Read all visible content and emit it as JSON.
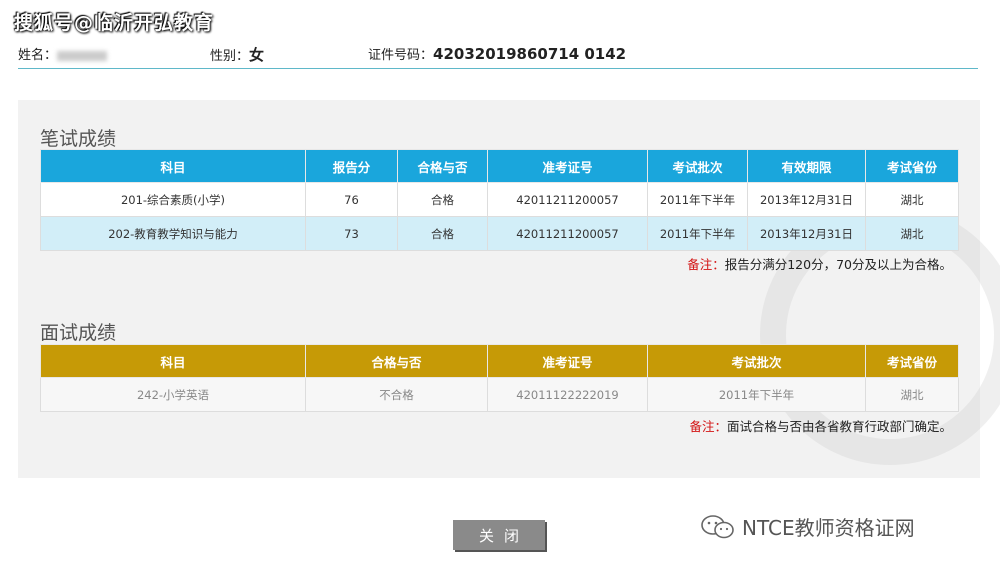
{
  "watermark_top": "搜狐号@临沂开弘教育",
  "info": {
    "name_label": "姓名：",
    "name_value": "",
    "gender_label": "性别：",
    "gender_value": "女",
    "id_label": "证件号码：",
    "id_value": "42032019860714 0142"
  },
  "written": {
    "title": "笔试成绩",
    "headers": [
      "科目",
      "报告分",
      "合格与否",
      "准考证号",
      "考试批次",
      "有效期限",
      "考试省份"
    ],
    "rows": [
      [
        "201-综合素质(小学)",
        "76",
        "合格",
        "42011211200057",
        "2011年下半年",
        "2013年12月31日",
        "湖北"
      ],
      [
        "202-教育教学知识与能力",
        "73",
        "合格",
        "42011211200057",
        "2011年下半年",
        "2013年12月31日",
        "湖北"
      ]
    ],
    "note_label": "备注：",
    "note_text": "报告分满分120分，70分及以上为合格。"
  },
  "oral": {
    "title": "面试成绩",
    "headers": [
      "科目",
      "合格与否",
      "准考证号",
      "考试批次",
      "考试省份"
    ],
    "rows": [
      [
        "242-小学英语",
        "不合格",
        "42011122222019",
        "2011年下半年",
        "湖北"
      ]
    ],
    "note_label": "备注：",
    "note_text": "面试合格与否由各省教育行政部门确定。"
  },
  "close_label": "关闭",
  "watermark_bottom": "NTCE教师资格证网",
  "colors": {
    "written_header": "#1aa6dc",
    "oral_header": "#c69a06",
    "note_label": "#d31414"
  }
}
